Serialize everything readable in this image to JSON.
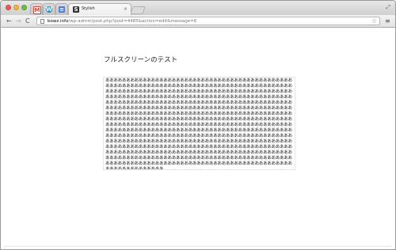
{
  "browser": {
    "tabs": [
      {
        "label": "",
        "icon": "gmail-icon",
        "icon_glyph": "M",
        "icon_color": "#d44638",
        "active": false
      },
      {
        "label": "",
        "icon": "wordpress-icon",
        "icon_glyph": "W",
        "icon_color": "#1e8cbe",
        "active": false
      },
      {
        "label": "",
        "icon": "blue-app-icon",
        "icon_glyph": "≡",
        "icon_color": "#4a7fd0",
        "active": false
      },
      {
        "label": "Stylish",
        "icon": "stylish-icon",
        "icon_glyph": "S",
        "icon_color": "#333333",
        "active": true,
        "close": "×"
      }
    ],
    "fullscreen_glyph": "⤢"
  },
  "toolbar": {
    "back_glyph": "←",
    "forward_glyph": "→",
    "reload_glyph": "C",
    "url_host": "bowz.info",
    "url_path": "/wp-admin/post.php?post=4485&action=edit&message=6",
    "star_glyph": "☆",
    "menu_glyph": "≡"
  },
  "page": {
    "title": "フルスクリーンのテスト",
    "body_text": "ああああああああああああああああああああああああああああああああああああああああああああああああああああああああああああああああああああああああああああああああああああああああああああああああああああああああああああああああああああああああああああああああああああああああああああああああああああああああああああああああああああああああああああああああああああああああああああああああああああああああああああああああああああああああああああああああああああああああああああああああああああああああああああああああああああああああああああああああああああああああああああああああああああああああああああああああああああああああああああああああああああああああああああああああああああああああああああああああああああああああああああああああああああああああああああああああああああああああああああああああああああああああああああああああああああああああああああああああああああああああああああああああああああああああああああああああああああああああああああああああああああああああああああああああああああああああああああああああああああああああああああああああああああああああああああああああああああああああああああああああああああああああああああああああああああああああああああああああああああああああああああああああああああああああああああああああああああああああああああああああああああああああああああああああああああああああああああああああああああああああああああああああああああああああああああああああああああああああああああああああああああああああああああああ"
  },
  "colors": {
    "close": "#ee5b53",
    "minimize": "#f3b63a",
    "maximize": "#6cc24a"
  }
}
